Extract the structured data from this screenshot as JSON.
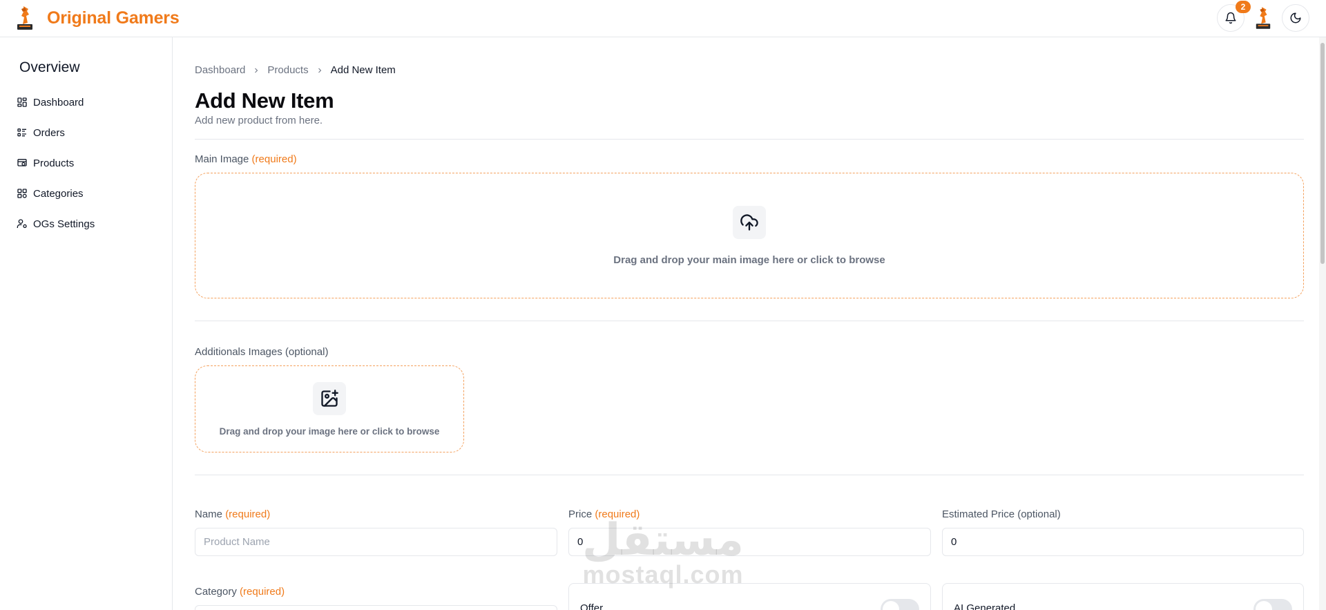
{
  "header": {
    "brand_name": "Original Gamers",
    "notification_count": "2",
    "accent_color": "#f07a1a"
  },
  "sidebar": {
    "title": "Overview",
    "items": [
      {
        "label": "Dashboard",
        "icon": "dashboard-grid-icon"
      },
      {
        "label": "Orders",
        "icon": "list-icon"
      },
      {
        "label": "Products",
        "icon": "products-icon"
      },
      {
        "label": "Categories",
        "icon": "categories-icon"
      },
      {
        "label": "OGs Settings",
        "icon": "user-settings-icon"
      }
    ]
  },
  "breadcrumb": {
    "items": [
      "Dashboard",
      "Products",
      "Add New Item"
    ]
  },
  "page": {
    "title": "Add New Item",
    "subtitle": "Add new product from here."
  },
  "main_image": {
    "label": "Main Image",
    "required_tag": "(required)",
    "dropzone_text": "Drag and drop your main image here or click to browse"
  },
  "additional_images": {
    "label": "Additionals Images (optional)",
    "dropzone_text": "Drag and drop your image here or click to browse"
  },
  "fields": {
    "name": {
      "label": "Name",
      "required_tag": "(required)",
      "placeholder": "Product Name",
      "value": ""
    },
    "price": {
      "label": "Price",
      "required_tag": "(required)",
      "value": "0"
    },
    "estimated_price": {
      "label": "Estimated Price (optional)",
      "value": "0"
    },
    "category": {
      "label": "Category",
      "required_tag": "(required)"
    }
  },
  "toggles": {
    "offer": {
      "label": "Offer",
      "checked": false
    },
    "ai_generated": {
      "label": "AI Generated",
      "checked": false
    }
  },
  "watermark": {
    "arabic": "مستقل",
    "latin": "mostaql.com"
  }
}
